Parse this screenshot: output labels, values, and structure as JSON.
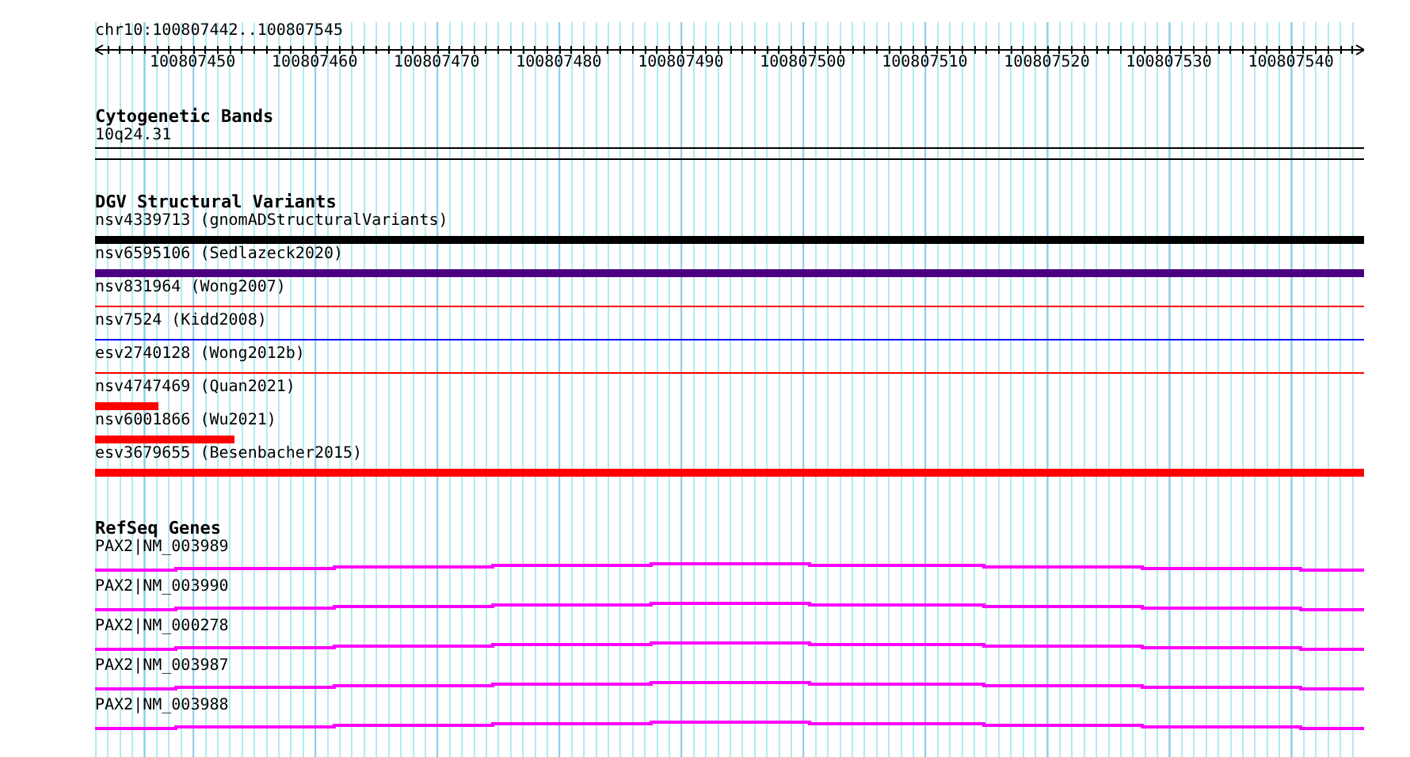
{
  "ruler": {
    "location": "chr10:100807442..100807545",
    "labels": [
      "100807450",
      "100807460",
      "100807470",
      "100807480",
      "100807490",
      "100807500",
      "100807510",
      "100807520",
      "100807530",
      "100807540"
    ]
  },
  "cytogenetic_bands": {
    "title": "Cytogenetic Bands",
    "band": "10q24.31"
  },
  "dgv_structural_variants": {
    "title": "DGV Structural Variants",
    "features": [
      {
        "label": "nsv4339713 (gnomADStructuralVariants)",
        "kind": "thick",
        "color": "#000000",
        "level": 1
      },
      {
        "label": "nsv6595106 (Sedlazeck2020)",
        "kind": "thick",
        "color": "#4b0082",
        "level": 1
      },
      {
        "label": "nsv831964 (Wong2007)",
        "kind": "thin",
        "color": "#ff0000",
        "level": 1
      },
      {
        "label": "nsv7524 (Kidd2008)",
        "kind": "thin",
        "color": "#0000ff",
        "level": 1
      },
      {
        "label": "esv2740128 (Wong2012b)",
        "kind": "thin",
        "color": "#ff0000",
        "level": 1
      },
      {
        "label": "nsv4747469 (Quan2021)",
        "kind": "thick",
        "color": "#ff0000",
        "level": 0.05
      },
      {
        "label": "nsv6001866 (Wu2021)",
        "kind": "thick",
        "color": "#ff0000",
        "level": 0.11
      },
      {
        "label": "esv3679655 (Besenbacher2015)",
        "kind": "thick",
        "color": "#ff0000",
        "level": 1
      }
    ]
  },
  "refseq_genes": {
    "title": "RefSeq Genes",
    "genes": [
      "PAX2|NM_003989",
      "PAX2|NM_003990",
      "PAX2|NM_000278",
      "PAX2|NM_003987",
      "PAX2|NM_003988"
    ]
  }
}
